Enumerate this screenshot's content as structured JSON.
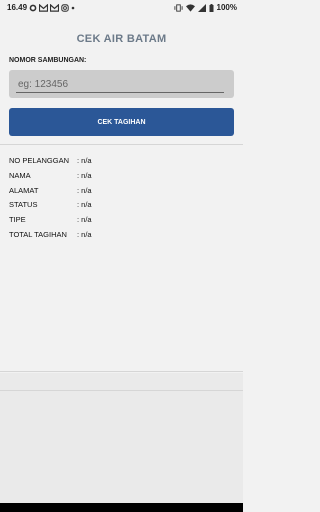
{
  "status_bar": {
    "time": "16.49",
    "battery": "100%",
    "icons_left": [
      "whatsapp-icon",
      "gmail-icon",
      "gmail-icon",
      "instagram-icon",
      "dot-icon"
    ],
    "icons_right": [
      "vibrate-icon",
      "wifi-icon",
      "signal-icon",
      "battery-icon"
    ]
  },
  "app": {
    "title": "CEK AIR BATAM",
    "input_label": "NOMOR SAMBUNGAN:",
    "input_placeholder": "eg: 123456",
    "input_value": "",
    "button_label": "CEK TAGIHAN"
  },
  "info": {
    "rows": [
      {
        "key": "NO PELANGGAN",
        "value": ": n/a"
      },
      {
        "key": "NAMA",
        "value": ": n/a"
      },
      {
        "key": "ALAMAT",
        "value": ": n/a"
      },
      {
        "key": "STATUS",
        "value": ": n/a"
      },
      {
        "key": "TIPE",
        "value": ": n/a"
      },
      {
        "key": "TOTAL TAGIHAN",
        "value": ": n/a"
      }
    ]
  },
  "colors": {
    "accent": "#2b5797",
    "title": "#6c7a89",
    "input_bg": "#cccccc",
    "background": "#f2f2f2"
  }
}
